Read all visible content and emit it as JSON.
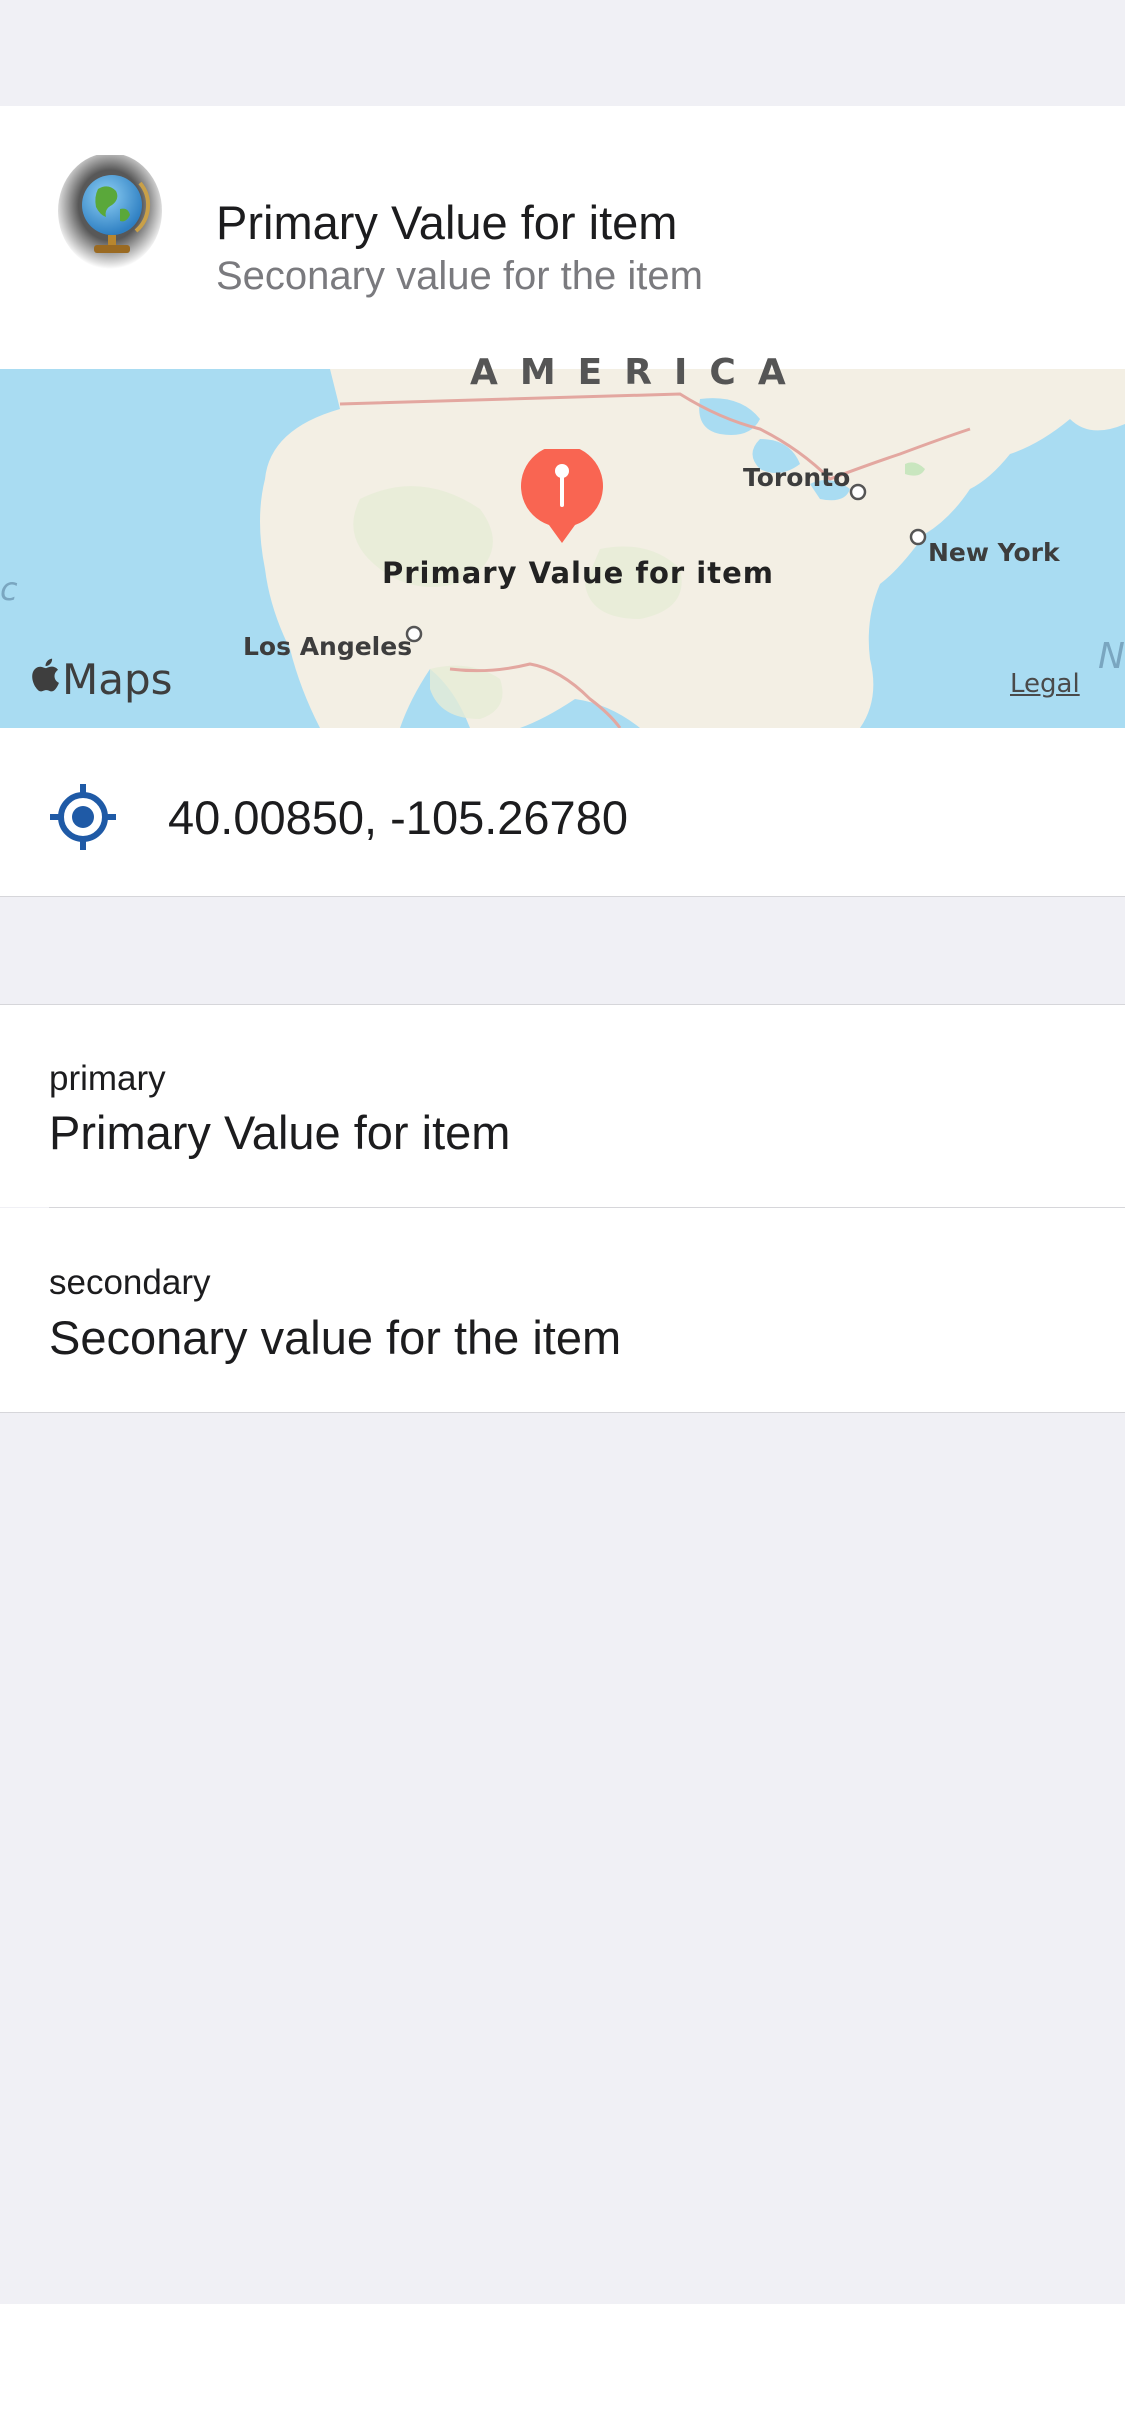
{
  "header": {
    "icon": "globe-icon",
    "title": "Primary Value for item",
    "subtitle": "Seconary value for the item"
  },
  "map": {
    "region_label": "AMERICA",
    "cities": {
      "toronto": "Toronto",
      "new_york": "New York",
      "los_angeles": "Los Angeles"
    },
    "pin_label": "Primary Value for item",
    "attribution": "Maps",
    "legal_link": "Legal",
    "edge_left": "c",
    "edge_right": "N",
    "pin_color": "#f96552",
    "water_color": "#a9dcf2",
    "land_color": "#f3efe4"
  },
  "location": {
    "icon": "location-target-icon",
    "coordinates": "40.00850, -105.26780",
    "icon_color": "#1f5aa6"
  },
  "details": [
    {
      "label": "primary",
      "value": "Primary Value for item"
    },
    {
      "label": "secondary",
      "value": "Seconary value for the item"
    }
  ]
}
